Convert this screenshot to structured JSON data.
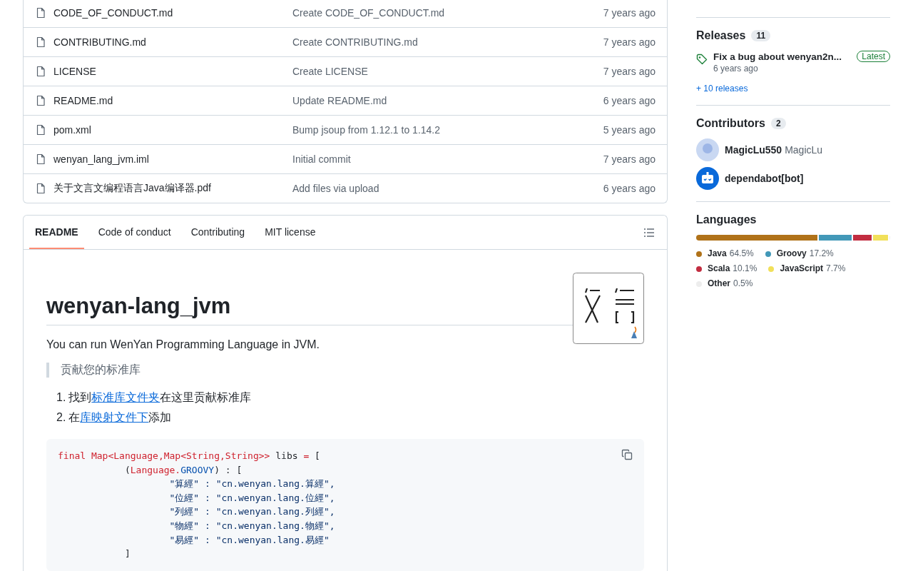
{
  "files": [
    {
      "name": "CODE_OF_CONDUCT.md",
      "commit": "Create CODE_OF_CONDUCT.md",
      "age": "7 years ago"
    },
    {
      "name": "CONTRIBUTING.md",
      "commit": "Create CONTRIBUTING.md",
      "age": "7 years ago"
    },
    {
      "name": "LICENSE",
      "commit": "Create LICENSE",
      "age": "7 years ago"
    },
    {
      "name": "README.md",
      "commit": "Update README.md",
      "age": "6 years ago"
    },
    {
      "name": "pom.xml",
      "commit": "Bump jsoup from 1.12.1 to 1.14.2",
      "age": "5 years ago"
    },
    {
      "name": "wenyan_lang_jvm.iml",
      "commit": "Initial commit",
      "age": "7 years ago"
    },
    {
      "name": "关于文言文编程语言Java编译器.pdf",
      "commit": "Add files via upload",
      "age": "6 years ago"
    }
  ],
  "readme": {
    "tabs": [
      {
        "label": "README",
        "selected": true
      },
      {
        "label": "Code of conduct",
        "selected": false
      },
      {
        "label": "Contributing",
        "selected": false
      },
      {
        "label": "MIT license",
        "selected": false
      }
    ],
    "title": "wenyan-lang_jvm",
    "intro": "You can run WenYan Programming Language in JVM.",
    "quote": "贡献您的标准库",
    "steps": [
      [
        {
          "kind": "text",
          "text": "找到"
        },
        {
          "kind": "link",
          "text": "标准库文件夹"
        },
        {
          "kind": "text",
          "text": "在这里贡献标准库"
        }
      ],
      [
        {
          "kind": "text",
          "text": "在"
        },
        {
          "kind": "link",
          "text": "库映射文件下"
        },
        {
          "kind": "text",
          "text": "添加"
        }
      ]
    ],
    "step_numbers": [
      "1.",
      "2."
    ],
    "code": [
      [
        {
          "kind": "kw",
          "text": "final Map<Language,Map<String,String>>"
        },
        {
          "kind": "plain",
          "text": " libs "
        },
        {
          "kind": "kw",
          "text": "="
        },
        {
          "kind": "plain",
          "text": " ["
        }
      ],
      [
        {
          "kind": "plain",
          "text": "            ("
        },
        {
          "kind": "kw",
          "text": "Language."
        },
        {
          "kind": "const",
          "text": "GROOVY"
        },
        {
          "kind": "plain",
          "text": ") : ["
        }
      ],
      [
        {
          "kind": "str",
          "text": "                    \"算經\" : \"cn.wenyan.lang.算經\","
        }
      ],
      [
        {
          "kind": "str",
          "text": "                    \"位經\" : \"cn.wenyan.lang.位經\","
        }
      ],
      [
        {
          "kind": "str",
          "text": "                    \"列經\" : \"cn.wenyan.lang.列經\","
        }
      ],
      [
        {
          "kind": "str",
          "text": "                    \"物經\" : \"cn.wenyan.lang.物經\","
        }
      ],
      [
        {
          "kind": "str",
          "text": "                    \"易經\" : \"cn.wenyan.lang.易經\""
        }
      ],
      [
        {
          "kind": "plain",
          "text": "            ]"
        }
      ]
    ]
  },
  "sidebar": {
    "releases": {
      "title": "Releases",
      "count": "11",
      "latest_name": "Fix a bug about wenyan2n...",
      "latest_badge": "Latest",
      "latest_age": "6 years ago",
      "more": "+ 10 releases"
    },
    "contributors": {
      "title": "Contributors",
      "count": "2",
      "people": [
        {
          "login": "MagicLu550",
          "name": "MagicLu",
          "kind": "user"
        },
        {
          "login": "dependabot[bot]",
          "kind": "bot"
        }
      ]
    },
    "languages": {
      "title": "Languages",
      "items": [
        {
          "name": "Java",
          "percent": "64.5%",
          "color": "#b07219"
        },
        {
          "name": "Groovy",
          "percent": "17.2%",
          "color": "#4298b8"
        },
        {
          "name": "Scala",
          "percent": "10.1%",
          "color": "#c22d40"
        },
        {
          "name": "JavaScript",
          "percent": "7.7%",
          "color": "#f1e05a"
        },
        {
          "name": "Other",
          "percent": "0.5%",
          "color": "#ededed"
        }
      ]
    }
  }
}
